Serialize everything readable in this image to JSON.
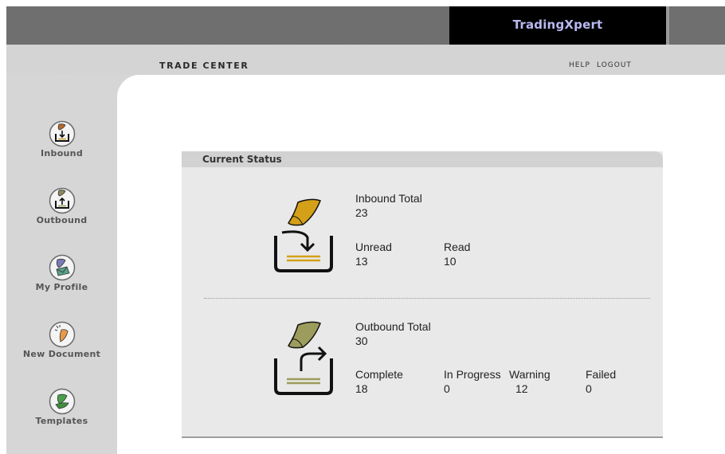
{
  "app": {
    "brand": "TradingXpert"
  },
  "header": {
    "section_title": "TRADE CENTER",
    "help": "HELP",
    "logout": "LOGOUT"
  },
  "sidebar": {
    "items": [
      {
        "label": "Inbound",
        "icon": "inbound-icon"
      },
      {
        "label": "Outbound",
        "icon": "outbound-icon"
      },
      {
        "label": "My Profile",
        "icon": "profile-icon"
      },
      {
        "label": "New Document",
        "icon": "new-document-icon"
      },
      {
        "label": "Templates",
        "icon": "templates-icon"
      }
    ]
  },
  "status": {
    "title": "Current Status",
    "inbound": {
      "total_label": "Inbound Total",
      "total": "23",
      "unread_label": "Unread",
      "unread": "13",
      "read_label": "Read",
      "read": "10"
    },
    "outbound": {
      "total_label": "Outbound Total",
      "total": "30",
      "complete_label": "Complete",
      "complete": "18",
      "in_progress_label": "In Progress",
      "in_progress": "0",
      "warning_label": "Warning",
      "warning": "12",
      "failed_label": "Failed",
      "failed": "0"
    }
  },
  "colors": {
    "brand_text": "#b9b9f2",
    "inbound_accent": "#d4a017",
    "outbound_accent": "#9c9c5c",
    "panel_bg": "#e9e9e9"
  }
}
